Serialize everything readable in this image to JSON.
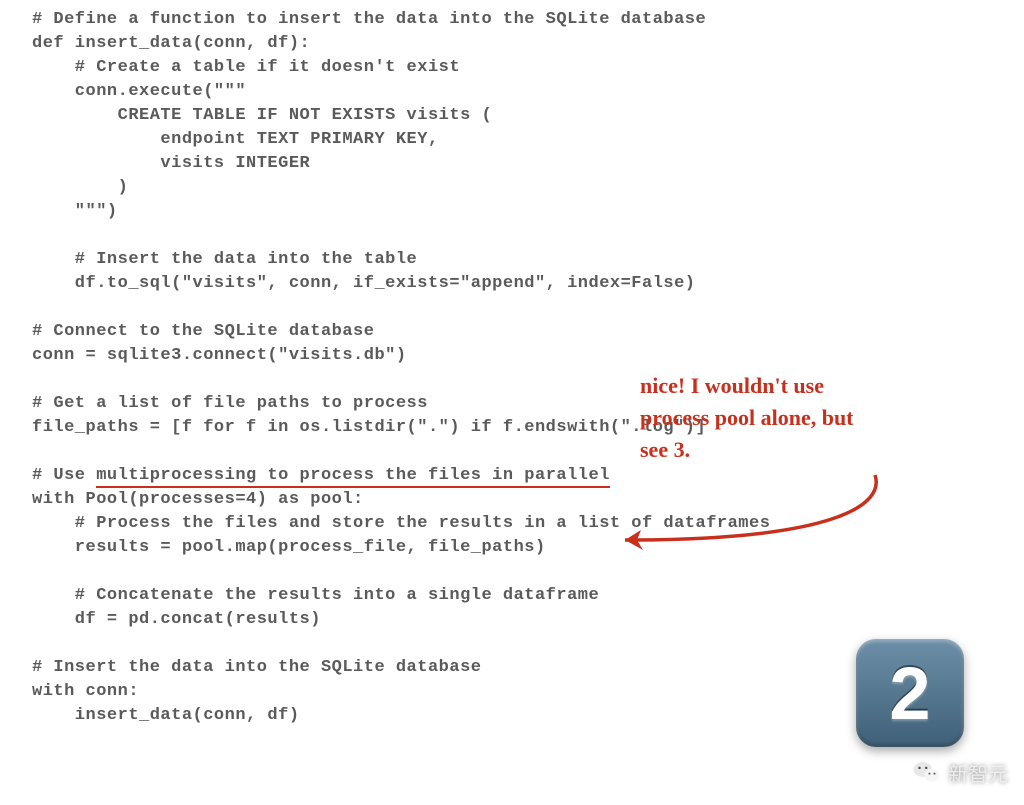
{
  "code": {
    "l01": "# Define a function to insert the data into the SQLite database",
    "l02": "def insert_data(conn, df):",
    "l03": "    # Create a table if it doesn't exist",
    "l04": "    conn.execute(\"\"\"",
    "l05": "        CREATE TABLE IF NOT EXISTS visits (",
    "l06": "            endpoint TEXT PRIMARY KEY,",
    "l07": "            visits INTEGER",
    "l08": "        )",
    "l09": "    \"\"\")",
    "l10": "",
    "l11": "    # Insert the data into the table",
    "l12": "    df.to_sql(\"visits\", conn, if_exists=\"append\", index=False)",
    "l13": "",
    "l14": "# Connect to the SQLite database",
    "l15": "conn = sqlite3.connect(\"visits.db\")",
    "l16": "",
    "l17": "# Get a list of file paths to process",
    "l18": "file_paths = [f for f in os.listdir(\".\") if f.endswith(\".log\")]",
    "l19": "",
    "l20a": "# Use ",
    "l20b": "multiprocessing to process the files in parallel",
    "l21": "with Pool(processes=4) as pool:",
    "l22": "    # Process the files and store the results in a list of dataframes",
    "l23": "    results = pool.map(process_file, file_paths)",
    "l24": "",
    "l25": "    # Concatenate the results into a single dataframe",
    "l26": "    df = pd.concat(results)",
    "l27": "",
    "l28": "# Insert the data into the SQLite database",
    "l29": "with conn:",
    "l30": "    insert_data(conn, df)"
  },
  "annotation": {
    "line1": "nice! I wouldn't use",
    "line2": "process pool alone, but",
    "line3": "see 3."
  },
  "badge": {
    "number": "2"
  },
  "watermark": {
    "text": "新智元"
  }
}
